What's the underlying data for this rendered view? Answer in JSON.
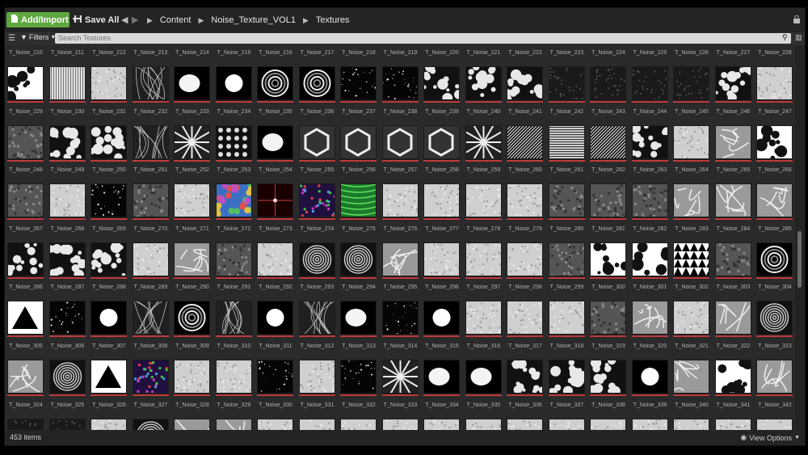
{
  "toolbar": {
    "add_import_label": "Add/Import",
    "add_import_icon": "new-file-icon",
    "save_all_label": "Save All",
    "save_icon": "save-icon",
    "breadcrumb": [
      "Content",
      "Noise_Texture_VOL1",
      "Textures"
    ],
    "back_icon": "arrow-left-icon",
    "forward_icon": "arrow-right-icon",
    "lock_icon": "lock-icon"
  },
  "filterbar": {
    "filters_label": "Filters",
    "search_placeholder": "Search Textures"
  },
  "grid": {
    "first_index": 210,
    "columns": 19,
    "rows": 7,
    "name_prefix": "T_Noise_",
    "thumb_styles": [
      [
        "blot",
        "lines-v",
        "noise-light",
        "strands",
        "blob",
        "dot",
        "ring",
        "ring",
        "stars",
        "stars",
        "cells",
        "cells",
        "cells",
        "noise-dark",
        "noise-dark",
        "noise-dark",
        "noise-dark",
        "cells",
        "noise-light"
      ],
      [
        "noise-gray",
        "cells",
        "cells",
        "strands",
        "starburst",
        "hexdots",
        "blob",
        "hex",
        "hex",
        "hex",
        "hex",
        "starburst",
        "lines-d",
        "lines-h",
        "lines-d",
        "cells",
        "noise-light",
        "swirl",
        "blot"
      ],
      [
        "noise-gray",
        "noise-light",
        "stars",
        "noise-gray",
        "noise-light",
        "rainbow",
        "flare",
        "colorcells",
        "greenwave",
        "noise-light",
        "noise-light",
        "noise-light",
        "noise-light",
        "noise-gray",
        "noise-gray",
        "noise-gray",
        "swirl",
        "swirl",
        "swirl"
      ],
      [
        "cells",
        "cells",
        "cells",
        "noise-light",
        "swirl",
        "noise-gray",
        "noise-light",
        "spiral",
        "spiral",
        "swirl",
        "noise-light",
        "noise-light",
        "noise-light",
        "noise-gray",
        "blot",
        "blot",
        "triangles",
        "noise-gray",
        "ring"
      ],
      [
        "triangle",
        "stars",
        "dot",
        "strands",
        "ring",
        "strands",
        "dot",
        "strands",
        "blob",
        "stars",
        "dot",
        "noise-light",
        "noise-light",
        "noise-light",
        "noise-gray",
        "swirl",
        "noise-light",
        "swirl",
        "spiral"
      ],
      [
        "swirl",
        "spiral",
        "triangle",
        "colorcells",
        "noise-light",
        "noise-light",
        "stars",
        "noise-light",
        "stars",
        "starburst",
        "blob",
        "blob",
        "cells",
        "cells",
        "cells",
        "dot",
        "swirl",
        "blot",
        "swirl"
      ],
      [
        "noise-dark",
        "noise-dark",
        "noise-light",
        "spiral",
        "swirl",
        "swirl",
        "noise-light",
        "noise-light",
        "noise-light",
        "noise-light",
        "noise-light",
        "noise-light",
        "noise-light",
        "noise-light",
        "noise-light",
        "noise-light",
        "noise-light",
        "noise-light",
        "noise-light"
      ]
    ],
    "accent_color": "#c03a3a"
  },
  "status": {
    "item_count": "453 items",
    "view_options_label": "View Options",
    "eye_icon": "eye-icon"
  }
}
